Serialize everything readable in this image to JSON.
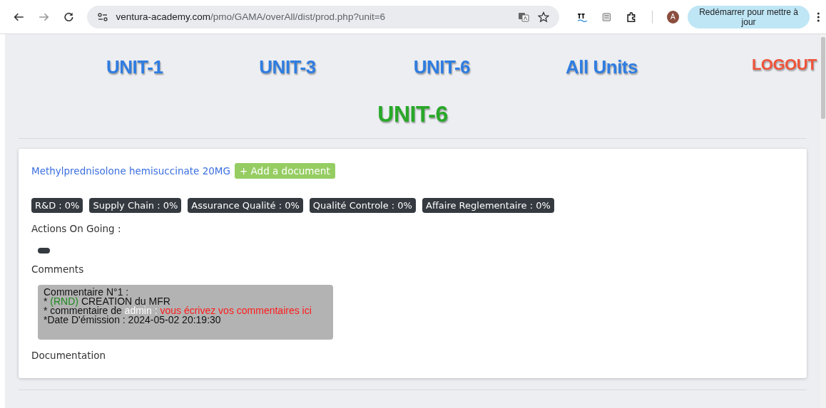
{
  "browser": {
    "url_domain": "ventura-academy.com",
    "url_path": "/pmo/GAMA/overAll/dist/prod.php?unit=6",
    "avatar": "A",
    "update_button": "Redémarrer pour mettre à jour"
  },
  "nav": [
    {
      "label": "UNIT-1",
      "kind": "unit"
    },
    {
      "label": "UNIT-3",
      "kind": "unit"
    },
    {
      "label": "UNIT-6",
      "kind": "unit"
    },
    {
      "label": "All Units",
      "kind": "unit"
    },
    {
      "label": "LOGOUT",
      "kind": "logout"
    }
  ],
  "heading": "UNIT-6",
  "product": {
    "name": "Methylprednisolone hemisuccinate 20MG",
    "add_button": "+ Add a document"
  },
  "badges": [
    "R&D : 0%",
    "Supply Chain : 0%",
    "Assurance Qualité : 0%",
    "Qualité Controle : 0%",
    "Affaire Reglementaire : 0%"
  ],
  "actions_label": "Actions On Going :",
  "comments_label": "Comments",
  "comment_lines": [
    [
      {
        "text": "Commentaire N°1 :",
        "kind": "plain"
      }
    ],
    [
      {
        "text": "* ",
        "kind": "plain"
      },
      {
        "text": "(RND)",
        "kind": "tag"
      },
      {
        "text": " CREATION du MFR",
        "kind": "plain"
      }
    ],
    [
      {
        "text": "* commentaire de ",
        "kind": "plain"
      },
      {
        "text": "admin : ",
        "kind": "user"
      },
      {
        "text": "vous écrivez vos commentaires ici",
        "kind": "message"
      }
    ],
    [
      {
        "text": "*Date D'émission : 2024-05-02 20:19:30",
        "kind": "plain"
      }
    ]
  ],
  "documentation_label": "Documentation"
}
